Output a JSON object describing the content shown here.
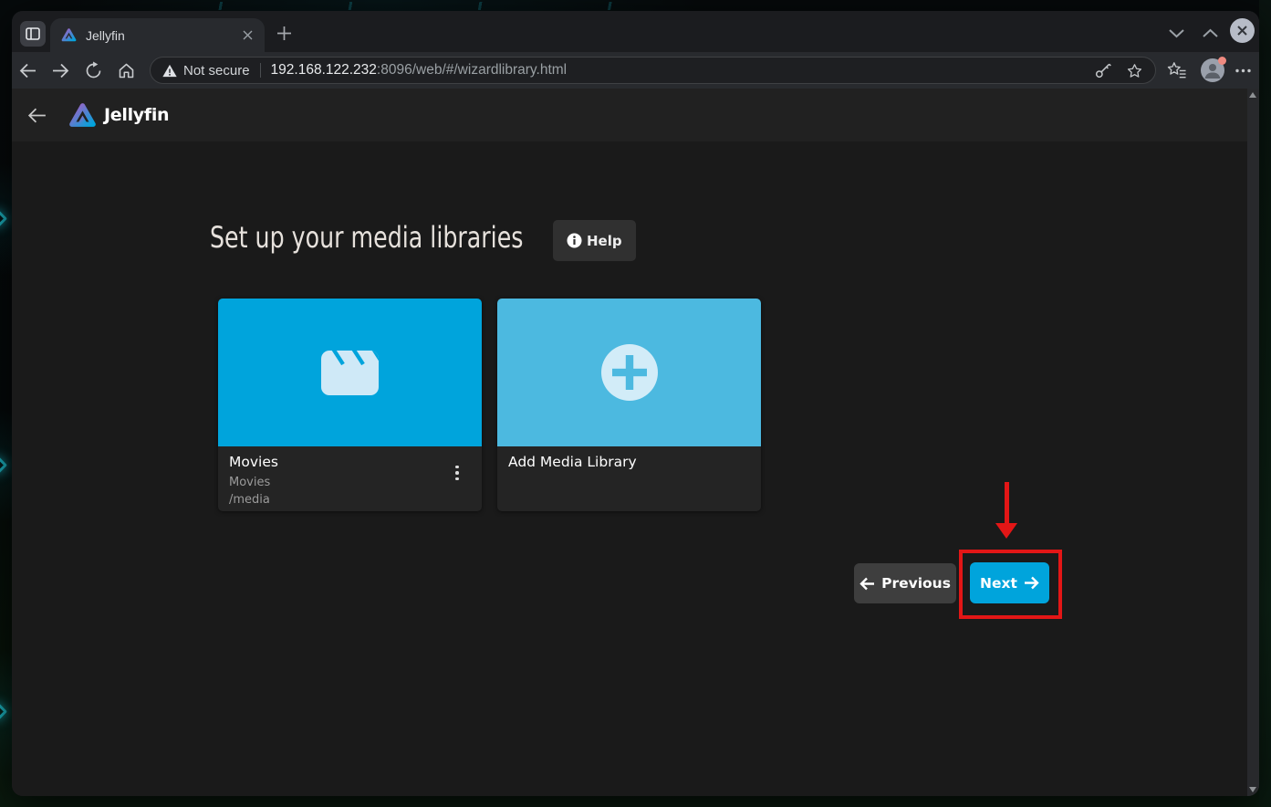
{
  "browser": {
    "tab_title": "Jellyfin",
    "security_label": "Not secure",
    "url": {
      "host": "192.168.122.232",
      "path": ":8096/web/#/wizardlibrary.html"
    }
  },
  "app": {
    "brand": "Jellyfin",
    "heading": "Set up your media libraries",
    "help_label": "Help",
    "libraries": [
      {
        "title": "Movies",
        "subtitle": "Movies",
        "path": "/media"
      }
    ],
    "add_library_label": "Add Media Library",
    "buttons": {
      "previous": "Previous",
      "next": "Next"
    }
  },
  "colors": {
    "accent": "#00a4dc",
    "add_card": "#4cb9e0",
    "annotation_red": "#e31616"
  }
}
